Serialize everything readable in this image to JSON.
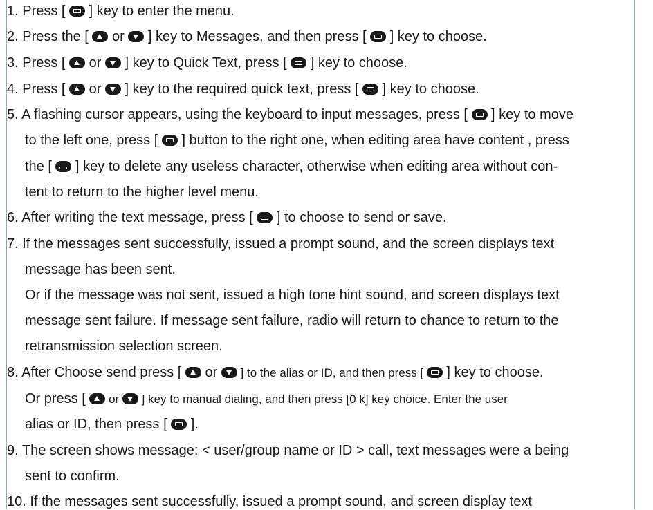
{
  "keys": {
    "menu": "menu-key",
    "up": "up-arrow-key",
    "down": "down-arrow-key",
    "delete": "back-delete-key"
  },
  "colors": {
    "rule": "#6fb2d9",
    "key_fill": "#1a1a1a",
    "text": "#1a1a1a"
  },
  "steps": {
    "s1": {
      "a": "1. Press [ ",
      "b": " ] key to enter the menu."
    },
    "s2": {
      "a": "2. Press  the [ ",
      "b": " or ",
      "c": " ] key to Messages, and then press [ ",
      "d": " ] key to choose."
    },
    "s3": {
      "a": "3. Press [ ",
      "b": " or ",
      "c": " ] key to Quick Text, press [ ",
      "d": " ] key to choose."
    },
    "s4": {
      "a": "4. Press [ ",
      "b": " or ",
      "c": " ] key to the required quick text, press [ ",
      "d": " ] key to choose."
    },
    "s5": {
      "l1a": "5. A flashing cursor appears, using the keyboard to input messages, press [ ",
      "l1b": " ] key to move",
      "l2a": "to the left one, press [ ",
      "l2b": " ] button to the right one, when editing area have content , press",
      "l3a": "the [ ",
      "l3b": " ] key to delete any useless character, otherwise when editing area without con-",
      "l4": "tent to return to the higher level menu."
    },
    "s6": {
      "a": "6. After writing the text message, press [ ",
      "b": " ]  to choose to send or save."
    },
    "s7": {
      "l1": "7. If the messages sent successfully, issued a prompt sound, and the screen displays text",
      "l2": "message has been sent.",
      "l3": "Or if the message was not sent, issued a high tone hint sound, and screen displays text",
      "l4": "message sent failure. If message sent failure, radio will return to  chance to return to the",
      "l5": "retransmission selection screen."
    },
    "s8": {
      "l1a": "8. After Choose send press [ ",
      "l1b": " or ",
      "l1c": " ] to the alias or ID, and then press [ ",
      "l1d": " ] key to choose.",
      "l2a": "Or  press  [ ",
      "l2b": " or ",
      "l2c": " ] key to manual dialing, and then press [0 k] key choice. Enter the user",
      "l3a": "alias or ID, then  press   [ ",
      "l3b": " ]."
    },
    "s9": {
      "l1": "9. The screen shows message: < user/group name or ID > call, text messages were a being",
      "l2": "sent to confirm."
    },
    "s10": {
      "l1": "10. If the messages sent successfully, issued a prompt sound, and screen display text"
    }
  }
}
